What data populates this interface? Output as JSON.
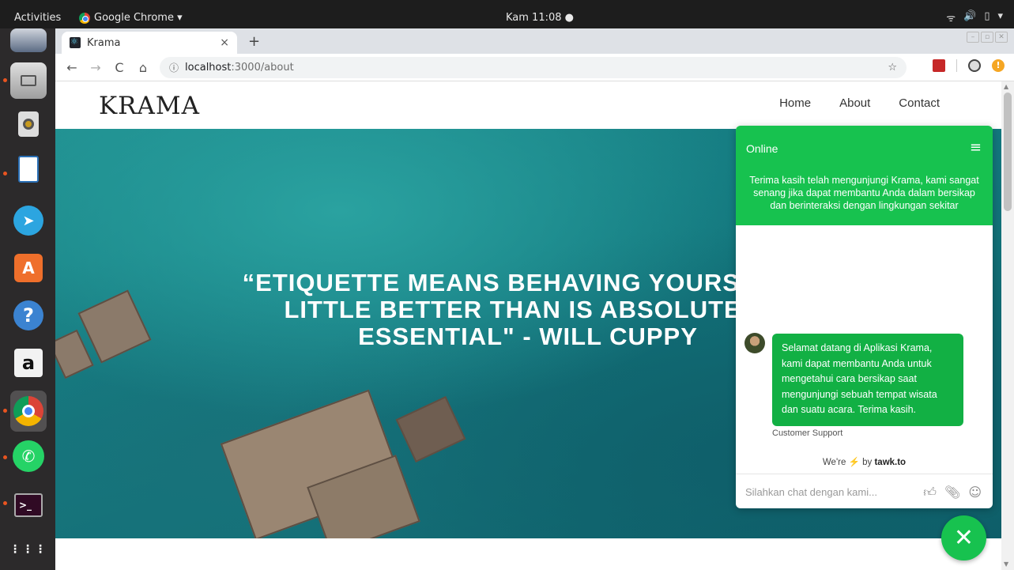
{
  "system": {
    "activities": "Activities",
    "app_name": "Google Chrome ▾",
    "clock": "Kam 11:08 ●",
    "tray": [
      "ᯤ",
      "🔊",
      "▯",
      "▾"
    ]
  },
  "dock": {
    "items": [
      "files-icon",
      "music-icon",
      "writer-icon",
      "telegram-icon",
      "software-icon",
      "help-icon",
      "amazon-icon",
      "chrome-icon",
      "whatsapp-icon",
      "terminal-icon",
      "apps-grid-icon"
    ]
  },
  "browser": {
    "tab_title": "Krama",
    "tab_close": "×",
    "new_tab": "+",
    "back": "←",
    "forward": "→",
    "reload": "C",
    "home": "⌂",
    "url_host": "localhost",
    "url_path": ":3000/about",
    "bookmark": "☆"
  },
  "site": {
    "brand": "KRAMA",
    "nav": [
      "Home",
      "About",
      "Contact"
    ],
    "quote": "“ETIQUETTE MEANS BEHAVING YOURSELF A LITTLE BETTER THAN IS ABSOLUTELY ESSENTIAL\" - WILL CUPPY"
  },
  "chat": {
    "status": "Online",
    "menu": "≡",
    "welcome": "Terima kasih telah mengunjungi Krama, kami sangat senang jika dapat membantu Anda dalam bersikap dan berinteraksi dengan lingkungan sekitar",
    "message": "Selamat datang di Aplikasi Krama, kami dapat membantu Anda untuk mengetahui cara bersikap saat mengunjungi sebuah tempat wisata dan suatu acara. Terima kasih.",
    "agent": "Customer Support",
    "powered_prefix": "We're",
    "powered_bolt": "⚡",
    "powered_by": "by",
    "powered_brand": "tawk.to",
    "input_placeholder": "Silahkan chat dengan kami...",
    "fab": "✕"
  }
}
